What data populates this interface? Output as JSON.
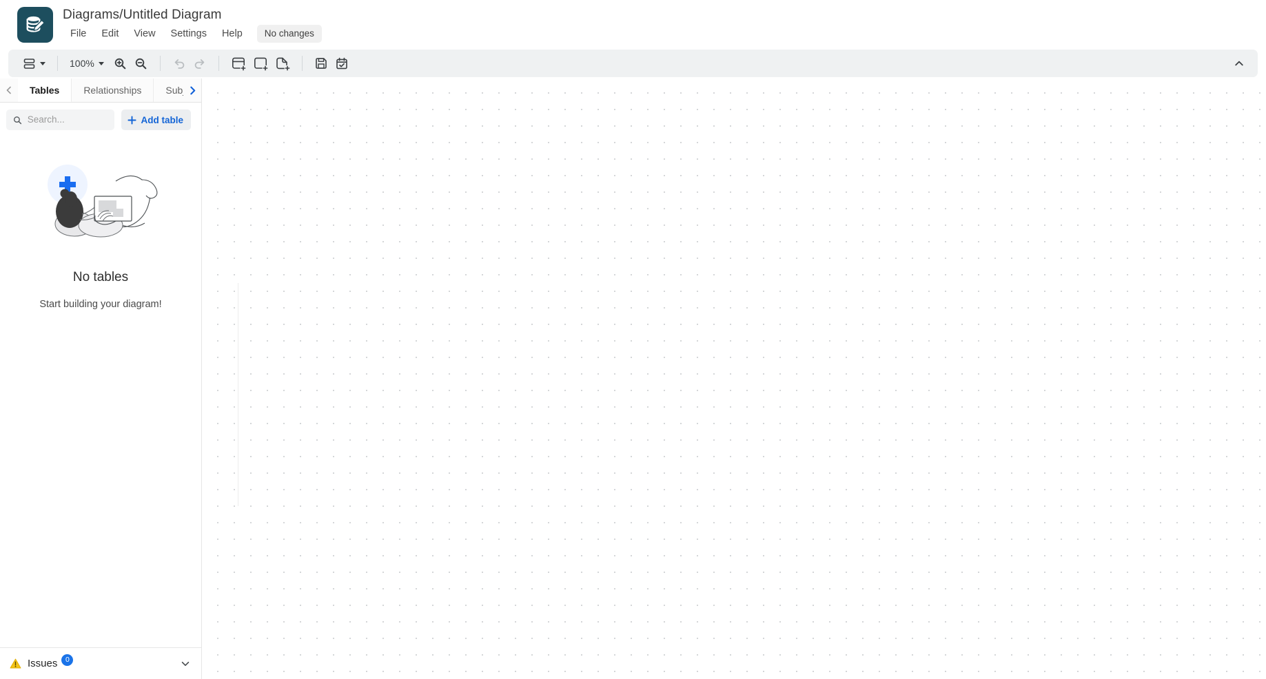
{
  "app": {
    "logo_icon": "database-pencil-icon",
    "brand_color": "#1d4e5e",
    "accent_color": "#1364d6"
  },
  "header": {
    "title": "Diagrams/Untitled Diagram",
    "menu": [
      {
        "label": "File"
      },
      {
        "label": "Edit"
      },
      {
        "label": "View"
      },
      {
        "label": "Settings"
      },
      {
        "label": "Help"
      }
    ],
    "status_badge": "No changes"
  },
  "toolbar": {
    "layout_icon": "rows-layout-icon",
    "zoom_level": "100%",
    "zoom_in_icon": "zoom-in-icon",
    "zoom_out_icon": "zoom-out-icon",
    "undo_icon": "undo-icon",
    "redo_icon": "redo-icon",
    "add_table_icon": "add-table-icon",
    "add_area_icon": "add-subject-area-icon",
    "add_note_icon": "add-note-icon",
    "save_icon": "save-icon",
    "commit_icon": "calendar-check-icon",
    "collapse_icon": "chevron-up-icon"
  },
  "sidebar": {
    "prev_tab_icon": "chevron-left-icon",
    "next_tab_icon": "chevron-right-icon",
    "tabs": [
      {
        "label": "Tables",
        "active": true
      },
      {
        "label": "Relationships",
        "active": false
      },
      {
        "label": "Subject Are",
        "active": false
      }
    ],
    "search": {
      "icon": "search-icon",
      "value": "",
      "placeholder": "Search..."
    },
    "add_table": {
      "icon": "plus-icon",
      "label": "Add table"
    },
    "empty_state": {
      "illustration": "person-with-laptop-illustration",
      "bubble_icon": "plus-icon",
      "title": "No tables",
      "subtitle": "Start building your diagram!"
    }
  },
  "issues": {
    "warning_icon": "warning-triangle-icon",
    "label": "Issues",
    "count": "0",
    "expand_icon": "chevron-down-icon"
  },
  "canvas": {
    "grid": "dot-grid",
    "grid_spacing_px": 24
  }
}
